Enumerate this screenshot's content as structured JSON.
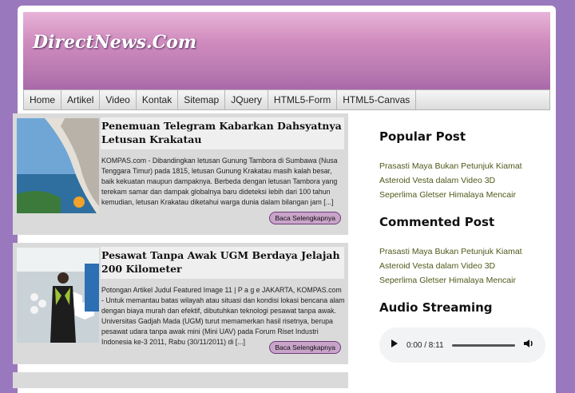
{
  "site": {
    "title": "DirectNews.Com"
  },
  "nav": [
    {
      "label": "Home"
    },
    {
      "label": "Artikel"
    },
    {
      "label": "Video"
    },
    {
      "label": "Kontak"
    },
    {
      "label": "Sitemap"
    },
    {
      "label": "JQuery"
    },
    {
      "label": "HTML5-Form"
    },
    {
      "label": "HTML5-Canvas"
    }
  ],
  "posts": [
    {
      "title": "Penemuan Telegram Kabarkan Dahsyatnya Letusan Krakatau",
      "excerpt": "KOMPAS.com - Dibandingkan letusan Gunung Tambora di Sumbawa (Nusa Tenggara Timur) pada 1815, letusan Gunung Krakatau masih kalah besar, baik kekuatan maupun dampaknya. Berbeda dengan letusan Tambora yang terekam samar dan dampak globalnya baru dideteksi lebih dari 100 tahun kemudian, letusan Krakatau diketahui warga dunia dalam bilangan jam [...]",
      "read_more": "Baca Selengkapnya"
    },
    {
      "title": "Pesawat Tanpa Awak UGM Berdaya Jelajah 200 Kilometer",
      "excerpt": "Potongan Artikel Judul Featured Image 11 | P a g e JAKARTA, KOMPAS.com - Untuk memantau batas wilayah atau situasi dan kondisi lokasi bencana alam dengan biaya murah dan efektif, dibutuhkan teknologi pesawat tanpa awak. Universitas Gadjah Mada (UGM) turut memamerkan hasil risetnya, berupa pesawat udara tanpa awak mini (Mini UAV) pada Forum Riset Industri Indonesia ke-3 2011, Rabu (30/11/2011) di [...]",
      "read_more": "Baca Selengkapnya"
    }
  ],
  "sidebar": {
    "popular": {
      "title": "Popular Post",
      "items": [
        "Prasasti Maya Bukan Petunjuk Kiamat",
        "Asteroid Vesta dalam Video 3D",
        "Seperlima Gletser Himalaya Mencair"
      ]
    },
    "commented": {
      "title": "Commented Post",
      "items": [
        "Prasasti Maya Bukan Petunjuk Kiamat",
        "Asteroid Vesta dalam Video 3D",
        "Seperlima Gletser Himalaya Mencair"
      ]
    },
    "audio": {
      "title": "Audio Streaming",
      "time": "0:00 / 8:11"
    }
  }
}
